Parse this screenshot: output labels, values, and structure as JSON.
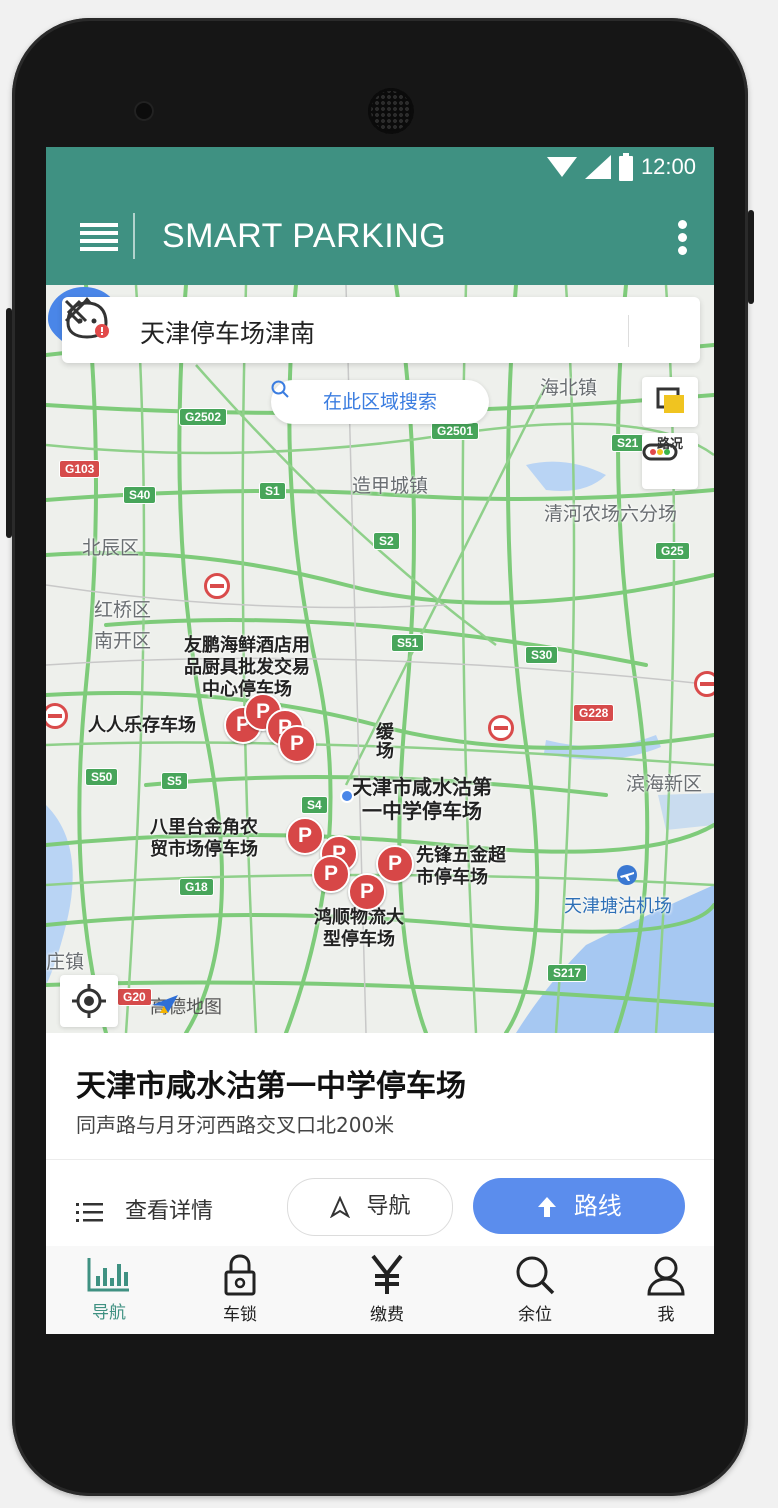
{
  "status_bar": {
    "time": "12:00"
  },
  "app_bar": {
    "title": "SMART PARKING"
  },
  "search": {
    "query": "天津停车场津南",
    "area_search_label": "在此区域搜索"
  },
  "map_controls": {
    "traffic_label": "路况",
    "map_provider": "高德地图"
  },
  "map_labels": {
    "haibei": "海北镇",
    "zaojia": "造甲城镇",
    "qinghe": "清河农场六分场",
    "beichen": "北辰区",
    "hongqiao": "红桥区",
    "nankai": "南开区",
    "binhai": "滨海新区",
    "zhuangzhen": "庄镇",
    "airport": "天津塘沽机场",
    "poi_youpeng_1": "友鹏海鲜酒店用",
    "poi_youpeng_2": "品厨具批发交易",
    "poi_youpeng_3": "中心停车场",
    "poi_renren": "人人乐存车场",
    "poi_selected_1": "天津市咸水沽第",
    "poi_selected_2": "一中学停车场",
    "poi_balitai_1": "八里台金角农",
    "poi_balitai_2": "贸市场停车场",
    "poi_xianfeng_1": "先锋五金超",
    "poi_xianfeng_2": "市停车场",
    "poi_hongshun_1": "鸿顺物流大",
    "poi_hongshun_2": "型停车场",
    "poi_partial_1": "缓",
    "poi_partial_2": "场"
  },
  "road_shields": {
    "g2502": "G2502",
    "g2501": "G2501",
    "g103": "G103",
    "s40": "S40",
    "s1": "S1",
    "s21": "S21",
    "s2": "S2",
    "g25": "G25",
    "s51": "S51",
    "s30": "S30",
    "g228": "G228",
    "s50": "S50",
    "s5": "S5",
    "s4": "S4",
    "g18": "G18",
    "s217": "S217",
    "g20": "G20"
  },
  "selected_place": {
    "name": "天津市咸水沽第一中学停车场",
    "address": "同声路与月牙河西路交叉口北200米",
    "details_label": "查看详情",
    "navigate_label": "导航",
    "route_label": "路线"
  },
  "tabs": [
    {
      "label": "导航",
      "icon": "chart-bars-icon"
    },
    {
      "label": "车锁",
      "icon": "lock-icon"
    },
    {
      "label": "缴费",
      "icon": "yen-icon"
    },
    {
      "label": "余位",
      "icon": "search-icon"
    },
    {
      "label": "我",
      "icon": "user-icon"
    }
  ],
  "colors": {
    "primary": "#3f9182",
    "accent_blue": "#5b8ded",
    "parking_marker": "#d74747",
    "selected_marker": "#4a86e8"
  }
}
